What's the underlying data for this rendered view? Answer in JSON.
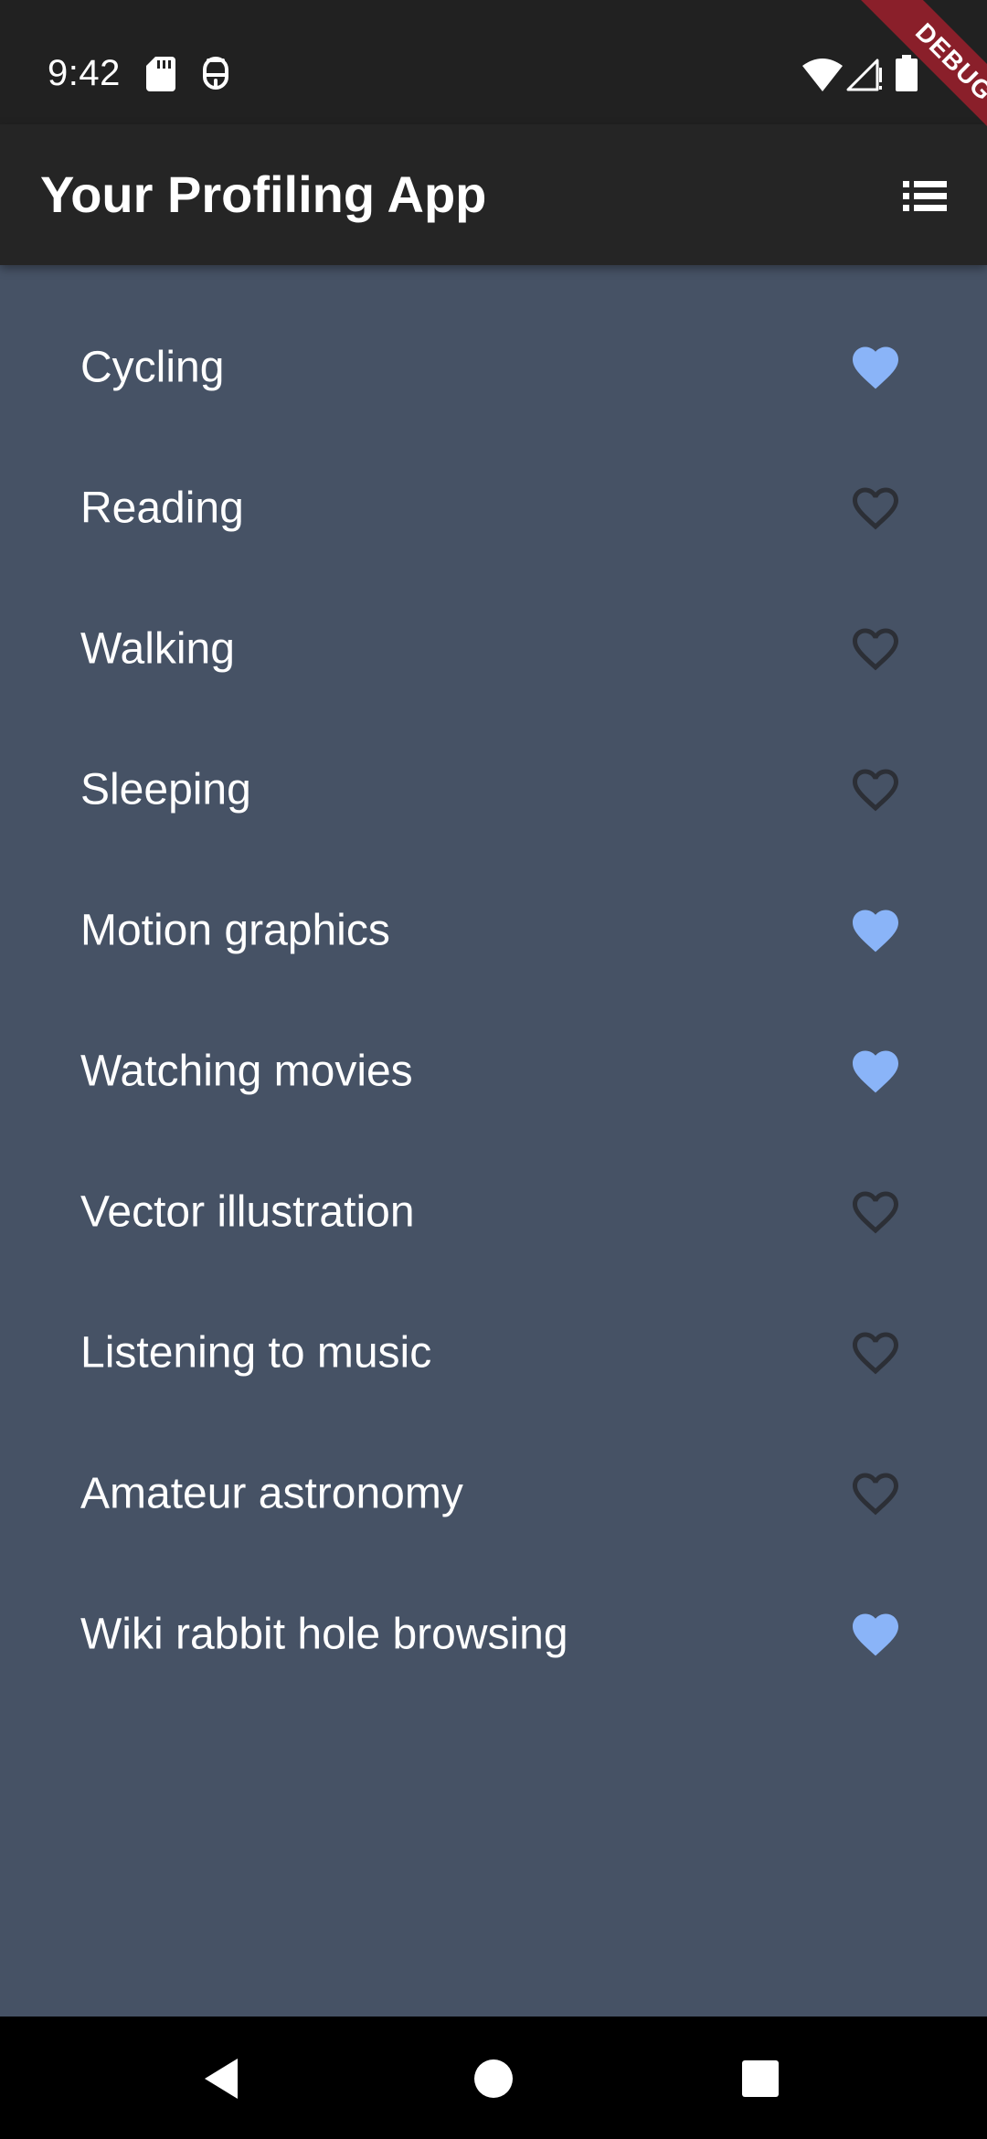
{
  "status_bar": {
    "time": "9:42",
    "icons": [
      "sd-card-icon",
      "accessibility-icon",
      "wifi-icon",
      "signal-icon",
      "battery-icon"
    ]
  },
  "debug_banner": {
    "label": "DEBUG"
  },
  "app_bar": {
    "title": "Your Profiling App",
    "menu_icon": "list-icon"
  },
  "colors": {
    "background": "#465265",
    "app_bar": "#252525",
    "favorite": "#8ab4f8",
    "heart_outline": "#2c2f36"
  },
  "items": [
    {
      "label": "Cycling",
      "favorite": true
    },
    {
      "label": "Reading",
      "favorite": false
    },
    {
      "label": "Walking",
      "favorite": false
    },
    {
      "label": "Sleeping",
      "favorite": false
    },
    {
      "label": "Motion graphics",
      "favorite": true
    },
    {
      "label": "Watching movies",
      "favorite": true
    },
    {
      "label": "Vector illustration",
      "favorite": false
    },
    {
      "label": "Listening to music",
      "favorite": false
    },
    {
      "label": "Amateur astronomy",
      "favorite": false
    },
    {
      "label": "Wiki rabbit hole browsing",
      "favorite": true
    }
  ],
  "nav_bar": {
    "buttons": [
      "back-icon",
      "home-icon",
      "recents-icon"
    ]
  }
}
